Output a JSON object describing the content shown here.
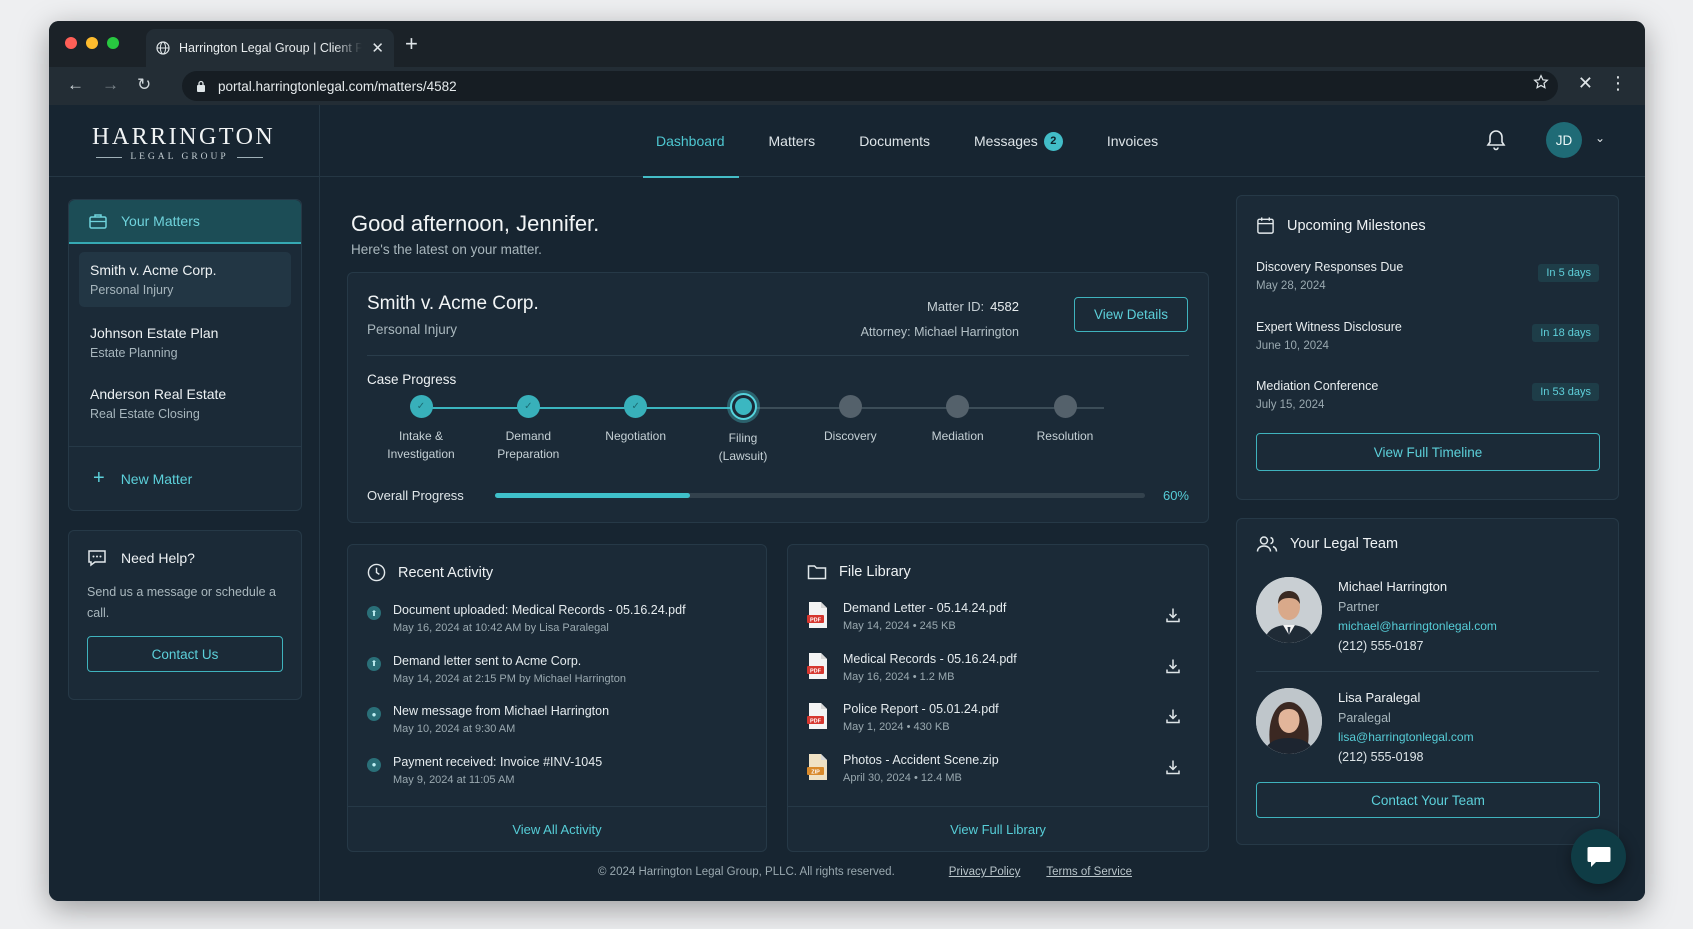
{
  "browser": {
    "tab_title": "Harrington Legal Group | Client Portal",
    "url": "portal.harringtonlegal.com/matters/4582"
  },
  "brand": {
    "name": "HARRINGTON",
    "sub": "LEGAL GROUP",
    "accent": "#44bdc7"
  },
  "nav": {
    "items": [
      "Dashboard",
      "Matters",
      "Documents",
      "Messages",
      "Invoices"
    ],
    "messages_badge": "2",
    "user_initials": "JD"
  },
  "sidebar": {
    "heading": "Your Matters",
    "matters": [
      {
        "name": "Smith v. Acme Corp.",
        "type": "Personal Injury"
      },
      {
        "name": "Johnson Estate Plan",
        "type": "Estate Planning"
      },
      {
        "name": "Anderson Real Estate",
        "type": "Real Estate Closing"
      }
    ],
    "new_matter": "New Matter",
    "help_title": "Need Help?",
    "help_text": "Send us a message or schedule a call.",
    "help_button": "Contact Us"
  },
  "greeting": {
    "title": "Good afternoon, Jennifer.",
    "subtitle": "Here's the latest on your matter."
  },
  "matter": {
    "title": "Smith v. Acme Corp.",
    "type": "Personal Injury",
    "id_label": "Matter ID:",
    "id_value": "4582",
    "attorney": "Attorney: Michael Harrington",
    "details_button": "View Details",
    "progress_label": "Case Progress",
    "steps": [
      {
        "line1": "Intake &",
        "line2": "Investigation",
        "state": "done"
      },
      {
        "line1": "Demand",
        "line2": "Preparation",
        "state": "done"
      },
      {
        "line1": "Negotiation",
        "line2": "",
        "state": "done"
      },
      {
        "line1": "Filing",
        "line2": "(Lawsuit)",
        "state": "current"
      },
      {
        "line1": "Discovery",
        "line2": "",
        "state": "todo"
      },
      {
        "line1": "Mediation",
        "line2": "",
        "state": "todo"
      },
      {
        "line1": "Resolution",
        "line2": "",
        "state": "todo"
      }
    ],
    "overall_label": "Overall Progress",
    "overall_value": 60,
    "overall_text": "60%"
  },
  "activity": {
    "title": "Recent Activity",
    "items": [
      {
        "title": "Document uploaded: Medical Records - 05.16.24.pdf",
        "meta": "May 16, 2024 at 10:42 AM by Lisa Paralegal",
        "icon": "upload-icon"
      },
      {
        "title": "Demand letter sent to Acme Corp.",
        "meta": "May 14, 2024 at 2:15 PM by Michael Harrington",
        "icon": "upload-icon"
      },
      {
        "title": "New message from Michael Harrington",
        "meta": "May 10, 2024 at 9:30 AM",
        "icon": "message-icon"
      },
      {
        "title": "Payment received: Invoice #INV-1045",
        "meta": "May 9, 2024 at 11:05 AM",
        "icon": "message-icon"
      }
    ],
    "footer": "View All Activity"
  },
  "files": {
    "title": "File Library",
    "items": [
      {
        "name": "Demand Letter - 05.14.24.pdf",
        "date": "May 14, 2024",
        "size": "245 KB",
        "kind": "PDF"
      },
      {
        "name": "Medical Records - 05.16.24.pdf",
        "date": "May 16, 2024",
        "size": "1.2 MB",
        "kind": "PDF"
      },
      {
        "name": "Police Report - 05.01.24.pdf",
        "date": "May 1, 2024",
        "size": "430 KB",
        "kind": "PDF"
      },
      {
        "name": "Photos - Accident Scene.zip",
        "date": "April 30, 2024",
        "size": "12.4 MB",
        "kind": "ZIP"
      }
    ],
    "footer": "View Full Library"
  },
  "milestones": {
    "title": "Upcoming Milestones",
    "items": [
      {
        "title": "Discovery Responses Due",
        "date": "May 28, 2024",
        "badge": "In 5 days"
      },
      {
        "title": "Expert Witness Disclosure",
        "date": "June 10, 2024",
        "badge": "In 18 days"
      },
      {
        "title": "Mediation Conference",
        "date": "July 15, 2024",
        "badge": "In 53 days"
      }
    ],
    "button": "View Full Timeline"
  },
  "team": {
    "title": "Your Legal Team",
    "members": [
      {
        "name": "Michael Harrington",
        "role": "Partner",
        "email": "michael@harringtonlegal.com",
        "phone": "(212) 555-0187"
      },
      {
        "name": "Lisa Paralegal",
        "role": "Paralegal",
        "email": "lisa@harringtonlegal.com",
        "phone": "(212) 555-0198"
      }
    ],
    "button": "Contact Your Team"
  },
  "footer": {
    "copyright": "© 2024 Harrington Legal Group, PLLC. All rights reserved.",
    "privacy": "Privacy Policy",
    "terms": "Terms of Service"
  }
}
